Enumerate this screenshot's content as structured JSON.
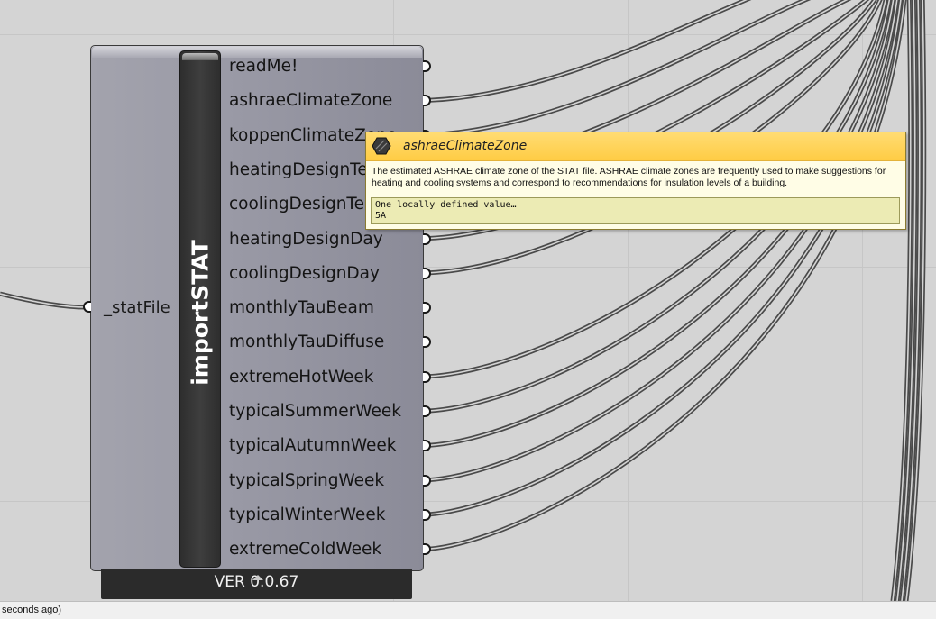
{
  "component": {
    "name": "importSTAT",
    "version": "VER 0.0.67",
    "inputs": [
      "_statFile"
    ],
    "outputs": [
      "readMe!",
      "ashraeClimateZone",
      "koppenClimateZone",
      "heatingDesignTemp",
      "coolingDesignTemp",
      "heatingDesignDay",
      "coolingDesignDay",
      "monthlyTauBeam",
      "monthlyTauDiffuse",
      "extremeHotWeek",
      "typicalSummerWeek",
      "typicalAutumnWeek",
      "typicalSpringWeek",
      "typicalWinterWeek",
      "extremeColdWeek"
    ]
  },
  "tooltip": {
    "title": "ashraeClimateZone",
    "description": "The estimated ASHRAE climate zone of the STAT file.  ASHRAE climate zones are frequently used to make suggestions for heating and cooling systems and correspond to recommendations for insulation levels of a building.",
    "value_line1": "One locally defined value…",
    "value_line2": "5A",
    "icon": "hexagon-param-icon"
  },
  "statusbar": {
    "text": "seconds ago)"
  },
  "colors": {
    "canvas": "#d4d4d4",
    "component_body": "#9a9aa6",
    "tooltip_header": "#ffcc44",
    "wire": "#4a4a4a"
  }
}
